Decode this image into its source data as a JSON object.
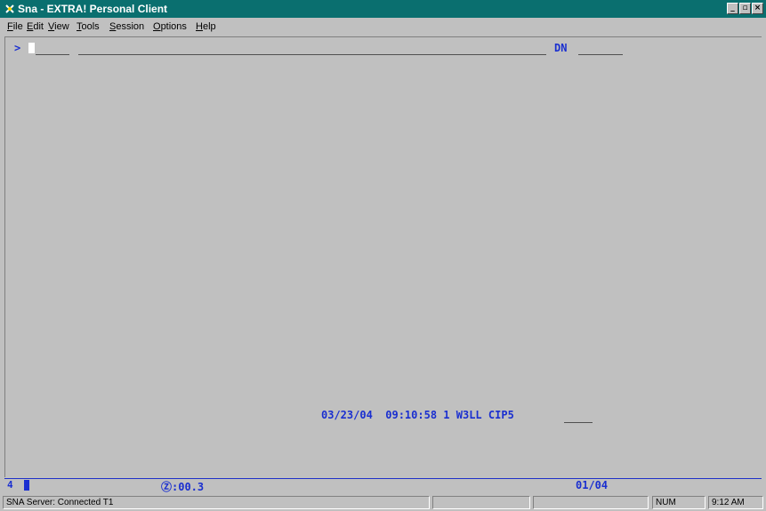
{
  "window": {
    "title": "Sna - EXTRA! Personal Client",
    "controls": {
      "minimize": "_",
      "maximize": "▫",
      "close": "×"
    }
  },
  "menu": [
    "File",
    "Edit",
    "View",
    "Tools",
    "Session",
    "Options",
    "Help"
  ],
  "menu_mnemonics": [
    "F",
    "E",
    "V",
    "T",
    "S",
    "O",
    "H"
  ],
  "terminal": {
    "prompt": ">",
    "dn_label": "DN",
    "timestamp": {
      "date": "03/23/04",
      "time": "09:10:58",
      "num": "1",
      "id": "W3LL",
      "code": "CIP5"
    },
    "text_color": "#1a2fd0"
  },
  "oia": {
    "indicator": "4",
    "timer": "Ⓩ:00.3",
    "position": "01/04"
  },
  "status": {
    "connection": "SNA Server: Connected T1",
    "num": "NUM",
    "clock": "9:12 AM"
  }
}
